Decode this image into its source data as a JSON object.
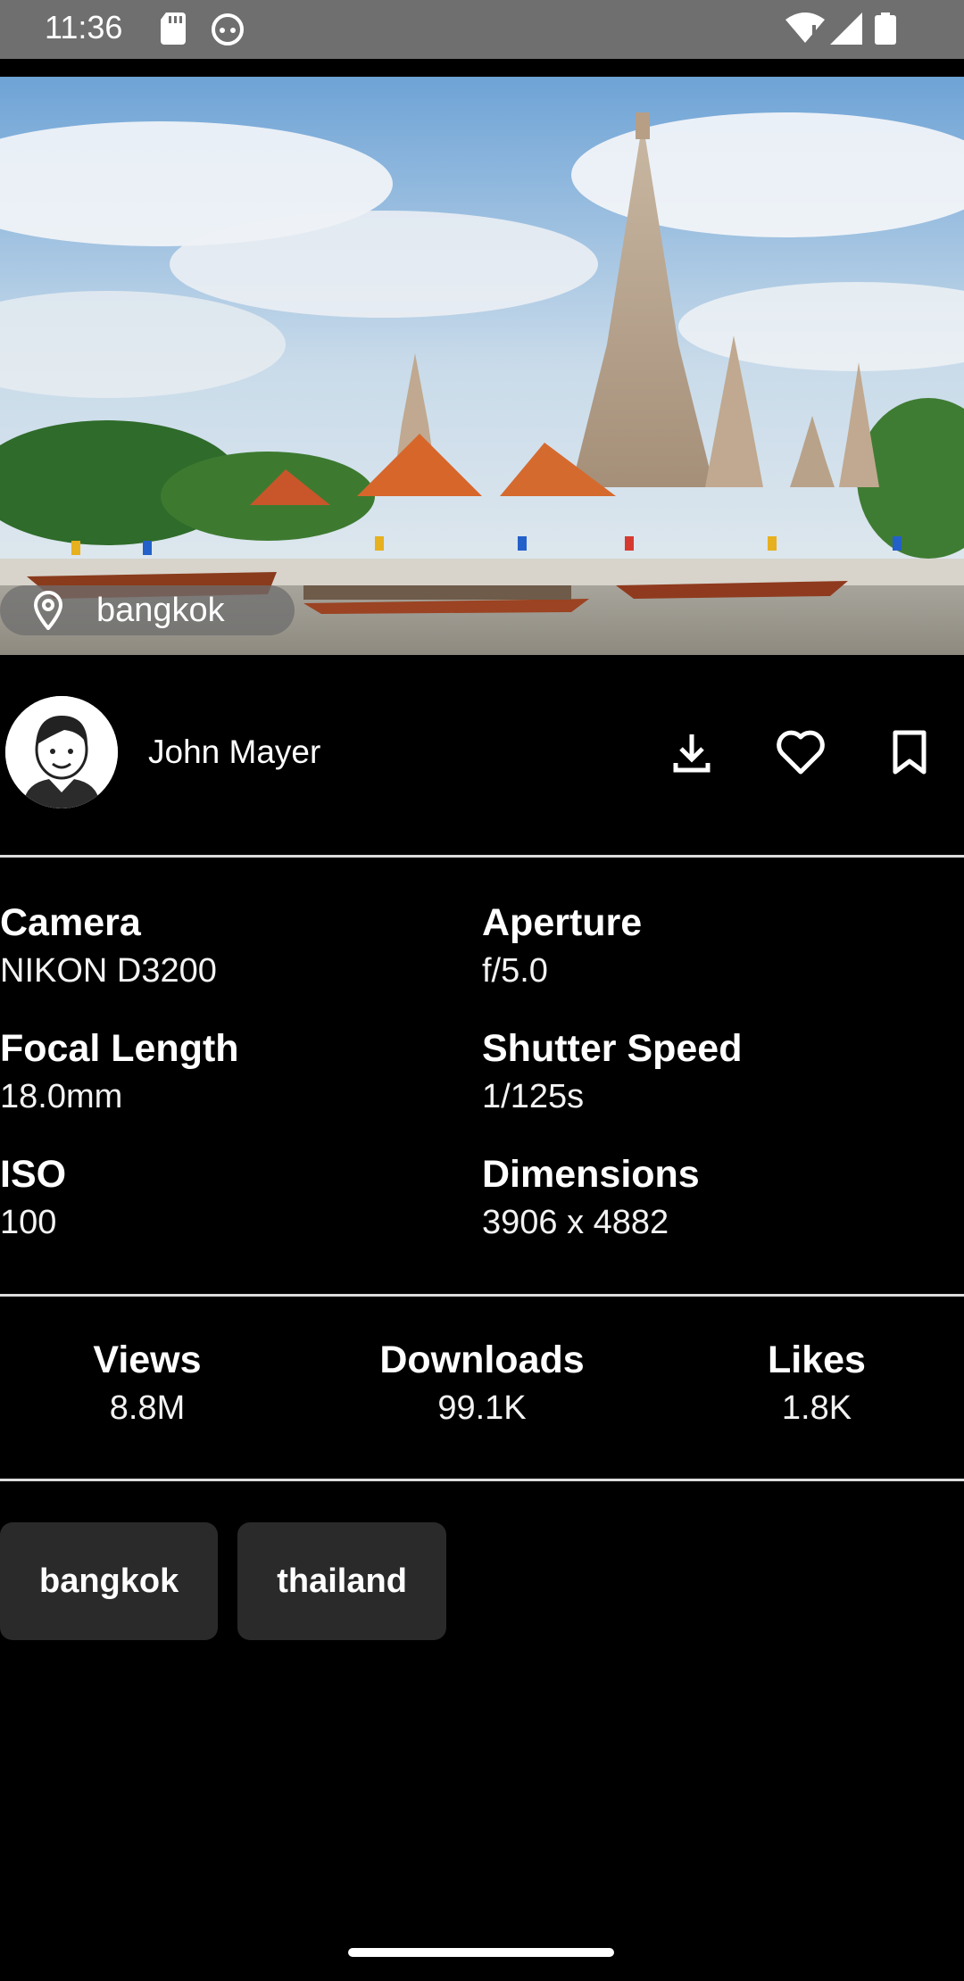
{
  "status_bar": {
    "time": "11:36"
  },
  "photo": {
    "location": "bangkok"
  },
  "author": {
    "name": "John Mayer"
  },
  "exif": [
    {
      "label": "Camera",
      "value": "NIKON D3200"
    },
    {
      "label": "Aperture",
      "value": "f/5.0"
    },
    {
      "label": "Focal Length",
      "value": "18.0mm"
    },
    {
      "label": "Shutter Speed",
      "value": "1/125s"
    },
    {
      "label": "ISO",
      "value": "100"
    },
    {
      "label": "Dimensions",
      "value": "3906 x 4882"
    }
  ],
  "stats": [
    {
      "label": "Views",
      "value": "8.8M"
    },
    {
      "label": "Downloads",
      "value": "99.1K"
    },
    {
      "label": "Likes",
      "value": "1.8K"
    }
  ],
  "tags": [
    "bangkok",
    "thailand"
  ],
  "icons": {
    "location": "map-pin-icon",
    "download": "download-icon",
    "like": "heart-icon",
    "bookmark": "bookmark-icon"
  },
  "colors": {
    "background": "#000000",
    "status_bar": "#6f6f6f",
    "tag_bg": "#2a2a2a",
    "divider": "#dcdcdc"
  }
}
